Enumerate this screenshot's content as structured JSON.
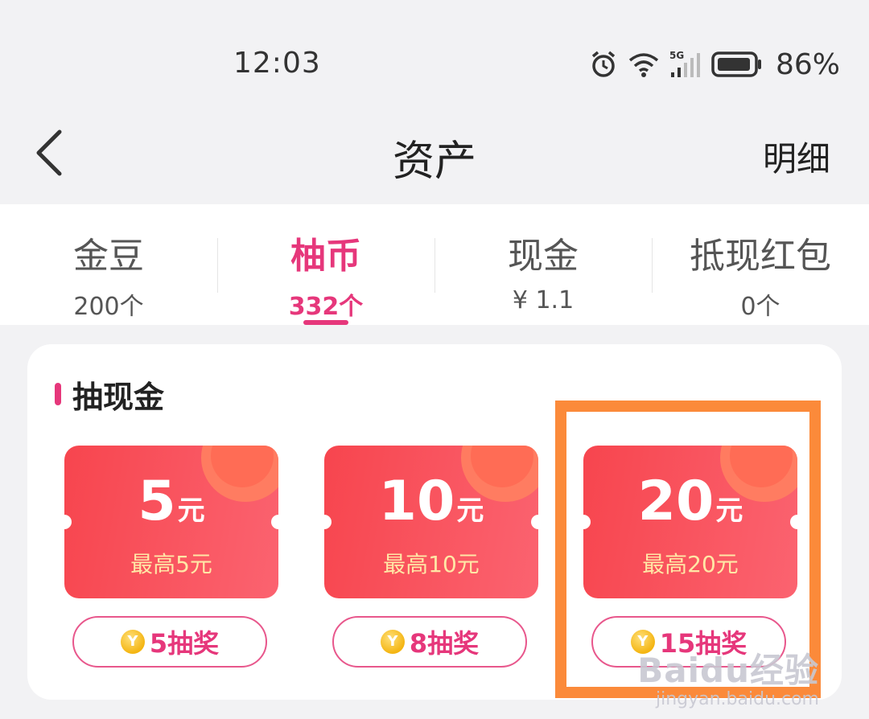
{
  "status_bar": {
    "time": "12:03",
    "network": "5G",
    "battery_percent": "86%"
  },
  "nav": {
    "title": "资产",
    "detail_label": "明细"
  },
  "tabs": [
    {
      "name": "金豆",
      "count": "200个",
      "active": false
    },
    {
      "name": "柚币",
      "count": "332个",
      "active": true
    },
    {
      "name": "现金",
      "count": "¥ 1.1",
      "active": false
    },
    {
      "name": "抵现红包",
      "count": "0个",
      "active": false
    }
  ],
  "section": {
    "title": "抽现金"
  },
  "prizes": [
    {
      "amount": "5",
      "unit": "元",
      "max_label": "最高5元",
      "draw_label": "5抽奖"
    },
    {
      "amount": "10",
      "unit": "元",
      "max_label": "最高10元",
      "draw_label": "8抽奖"
    },
    {
      "amount": "20",
      "unit": "元",
      "max_label": "最高20元",
      "draw_label": "15抽奖"
    }
  ],
  "watermark": {
    "main": "Baidu经验",
    "sub": "jingyan.baidu.com"
  },
  "colors": {
    "accent": "#e6377b",
    "ticket_red": "#f7454e",
    "highlight_orange": "#fb8a3a"
  }
}
